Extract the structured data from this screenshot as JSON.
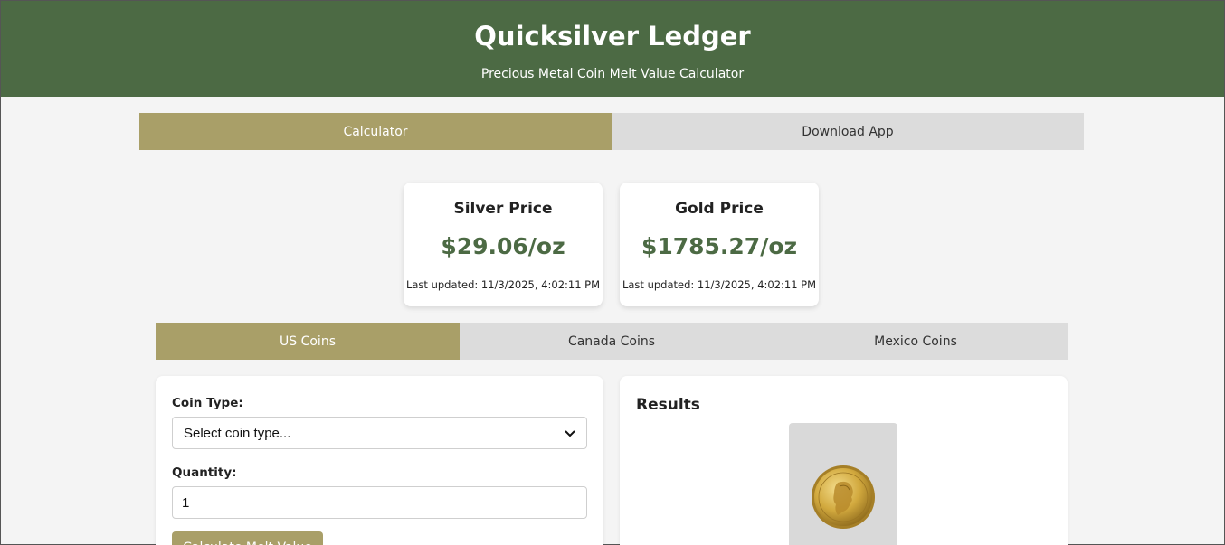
{
  "header": {
    "title": "Quicksilver Ledger",
    "subtitle": "Precious Metal Coin Melt Value Calculator"
  },
  "main_tabs": [
    {
      "label": "Calculator",
      "active": true
    },
    {
      "label": "Download App",
      "active": false
    }
  ],
  "prices": {
    "silver": {
      "label": "Silver Price",
      "value": "$29.06/oz",
      "updated": "Last updated: 11/3/2025, 4:02:11 PM"
    },
    "gold": {
      "label": "Gold Price",
      "value": "$1785.27/oz",
      "updated": "Last updated: 11/3/2025, 4:02:11 PM"
    }
  },
  "coin_tabs": [
    {
      "label": "US Coins",
      "active": true
    },
    {
      "label": "Canada Coins",
      "active": false
    },
    {
      "label": "Mexico Coins",
      "active": false
    }
  ],
  "form": {
    "coin_type_label": "Coin Type:",
    "coin_type_selected": "Select coin type...",
    "quantity_label": "Quantity:",
    "quantity_value": "1",
    "calculate_button_label": "Calculate Melt Value"
  },
  "results": {
    "title": "Results",
    "coin_image_icon": "quarter-coin-icon"
  },
  "colors": {
    "header_bg": "#4c6a44",
    "accent": "#a99f68",
    "price_text": "#4c6a44",
    "inactive_tab": "#dcdcdc"
  }
}
